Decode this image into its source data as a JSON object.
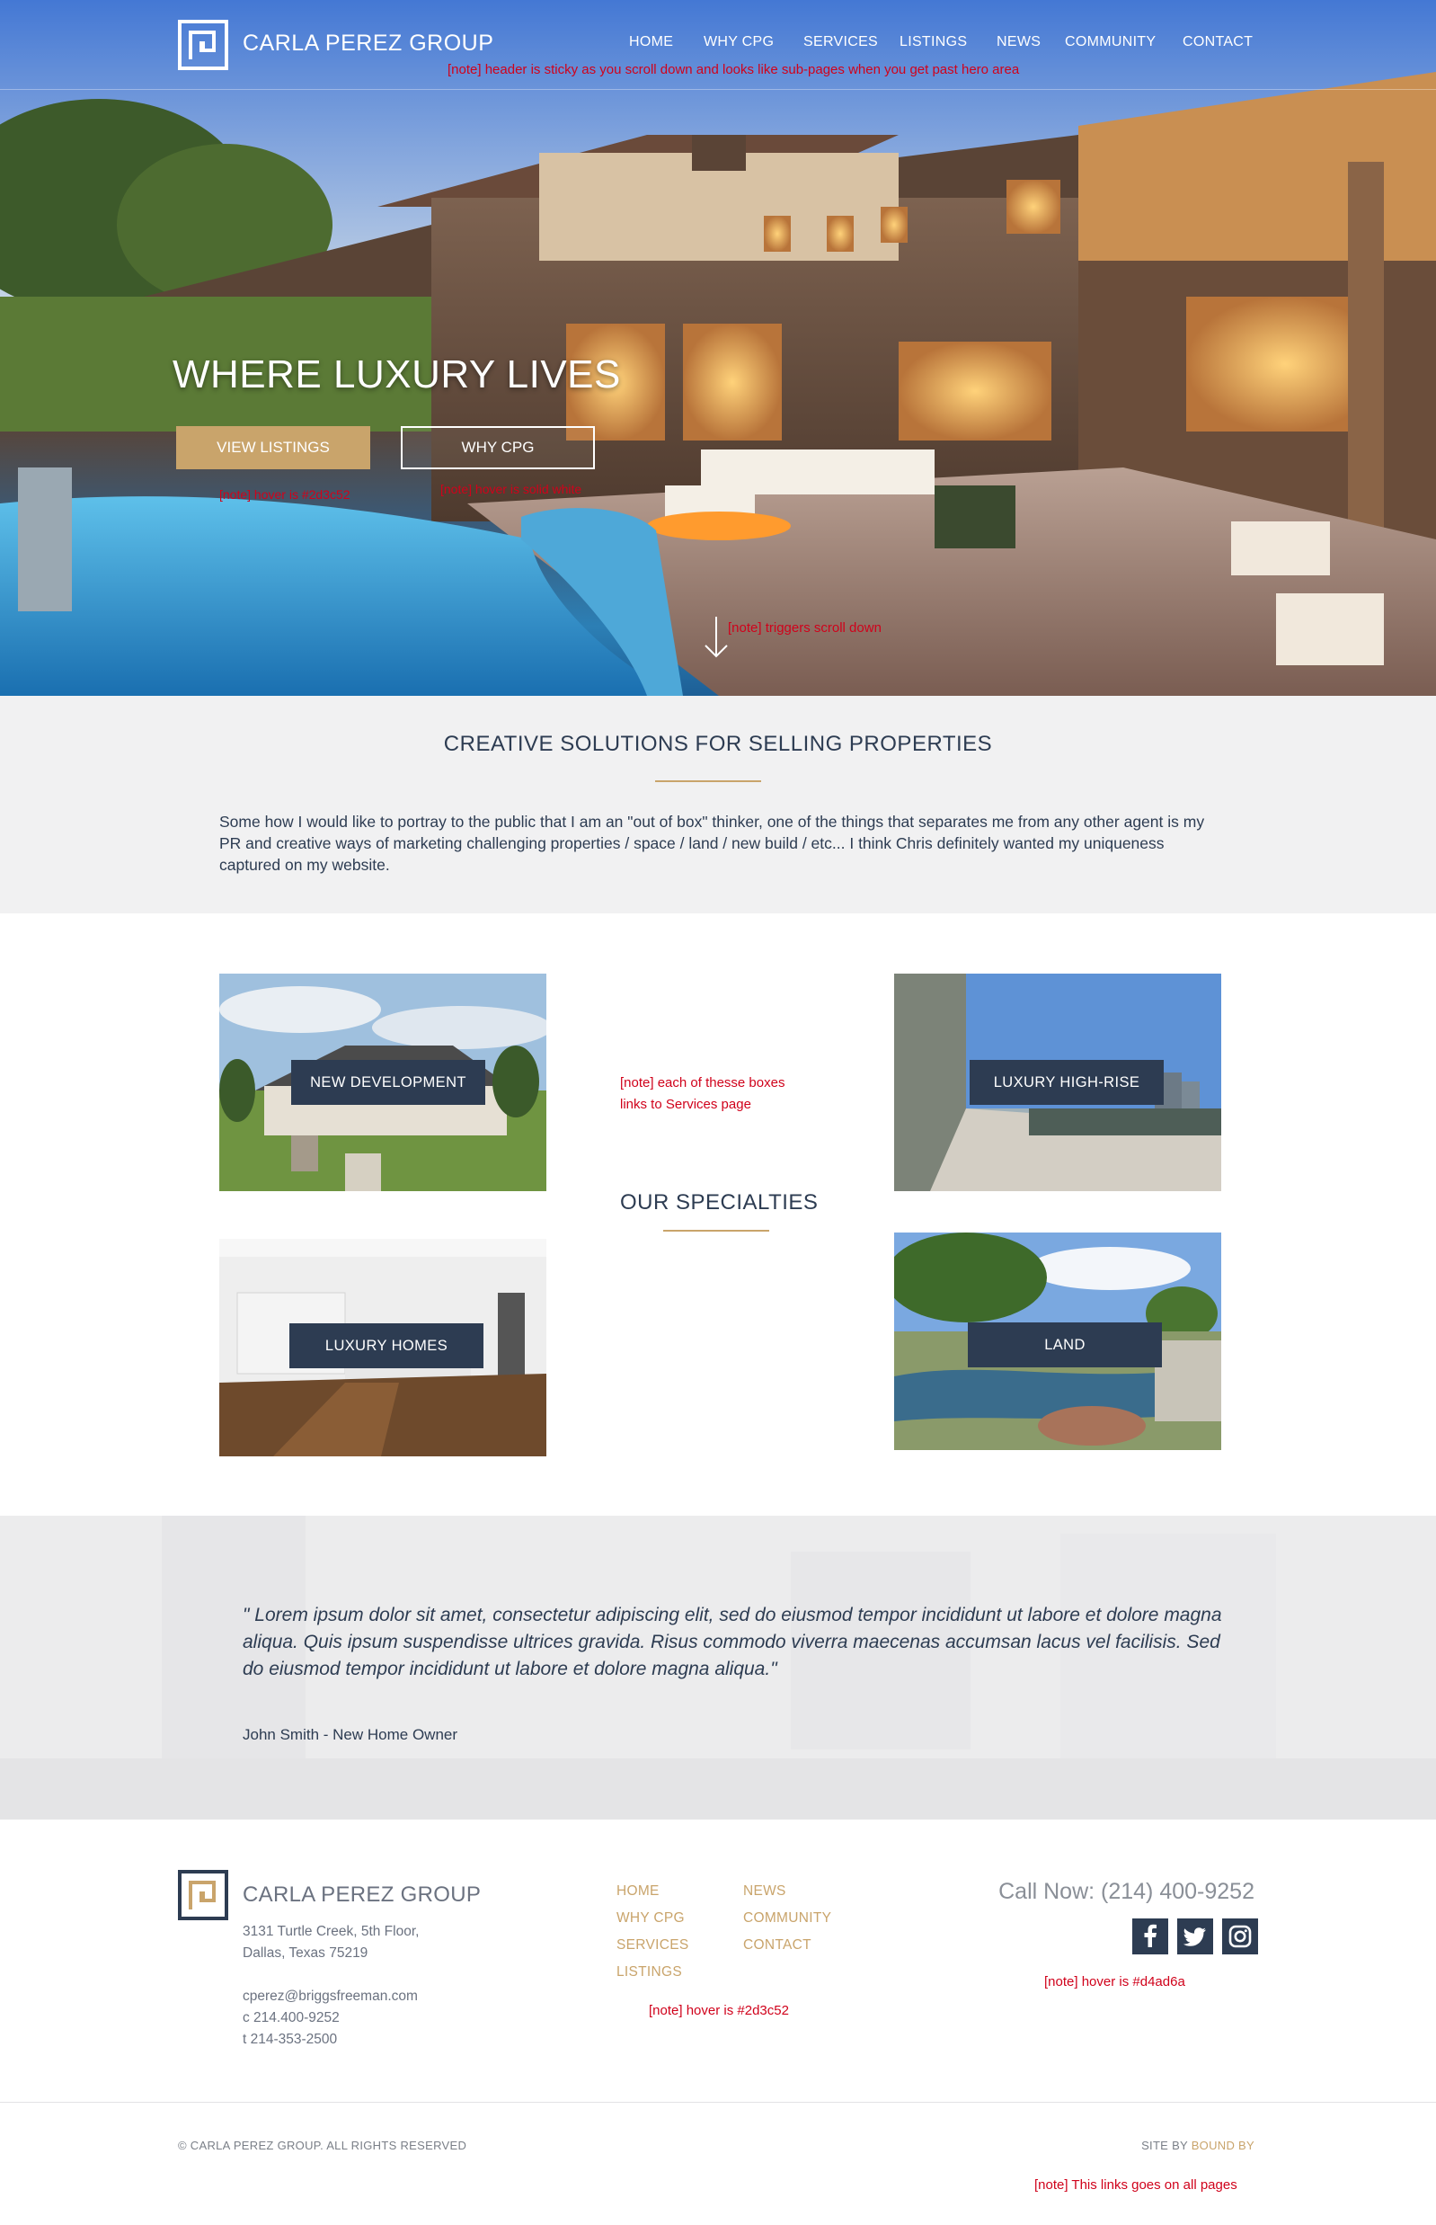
{
  "header": {
    "brand": "CARLA PEREZ GROUP",
    "nav": [
      "HOME",
      "WHY CPG",
      "SERVICES",
      "LISTINGS",
      "NEWS",
      "COMMUNITY",
      "CONTACT"
    ],
    "note": "[note] header is sticky as you scroll down and looks like sub-pages when you get past hero area"
  },
  "hero": {
    "title": "WHERE LUXURY LIVES",
    "btn_listings": "VIEW LISTINGS",
    "btn_why": "WHY CPG",
    "note_listings": "[note] hover is #2d3c52",
    "note_why": "[note] hover is solid white",
    "note_scroll": "[note] triggers scroll down"
  },
  "creative": {
    "title": "CREATIVE SOLUTIONS FOR SELLING  PROPERTIES",
    "body": "Some how I would like to portray to the public that I am an \"out of box\" thinker, one of the things that separates me from any other agent is my PR and creative ways of marketing challenging  properties / space / land / new build / etc... I think Chris definitely wanted my uniqueness captured on my website."
  },
  "specialties": {
    "title": "OUR SPECIALTIES",
    "note_line1": "[note] each of thesse boxes",
    "note_line2": "links to Services page",
    "cards": [
      "NEW DEVELOPMENT",
      "LUXURY HIGH-RISE",
      "LUXURY HOMES",
      "LAND"
    ]
  },
  "testimonial": {
    "quote": "\" Lorem ipsum dolor sit amet, consectetur adipiscing elit, sed do eiusmod tempor incididunt ut labore et dolore magna aliqua. Quis ipsum suspendisse ultrices gravida. Risus commodo viverra maecenas accumsan lacus vel facilisis. Sed do eiusmod tempor incididunt ut labore et dolore magna aliqua.\"",
    "author": "John Smith - New Home Owner"
  },
  "footer": {
    "brand": "CARLA PEREZ GROUP",
    "address_line1": "3131 Turtle Creek, 5th Floor,",
    "address_line2": "Dallas, Texas  75219",
    "email": "cperez@briggsfreeman.com",
    "cell": "c 214.400-9252",
    "phone": "t 214-353-2500",
    "links_col1": [
      "HOME",
      "WHY CPG",
      "SERVICES",
      "LISTINGS"
    ],
    "links_col2": [
      "NEWS",
      "COMMUNITY",
      "CONTACT"
    ],
    "links_note": "[note] hover is #2d3c52",
    "call_now": "Call Now: (214) 400-9252",
    "social": [
      "facebook-icon",
      "twitter-icon",
      "instagram-icon"
    ],
    "social_note": "[note] hover is #d4ad6a",
    "copyright": "© CARLA PEREZ GROUP. ALL RIGHTS RESERVED",
    "site_by_prefix": "SITE BY ",
    "site_by_link": "BOUND BY",
    "site_by_note": "[note] This links goes on all pages"
  },
  "colors": {
    "navy": "#2d3c52",
    "gold": "#c9a46b",
    "gold_hover": "#d4ad6a",
    "note_red": "#d0021b"
  }
}
